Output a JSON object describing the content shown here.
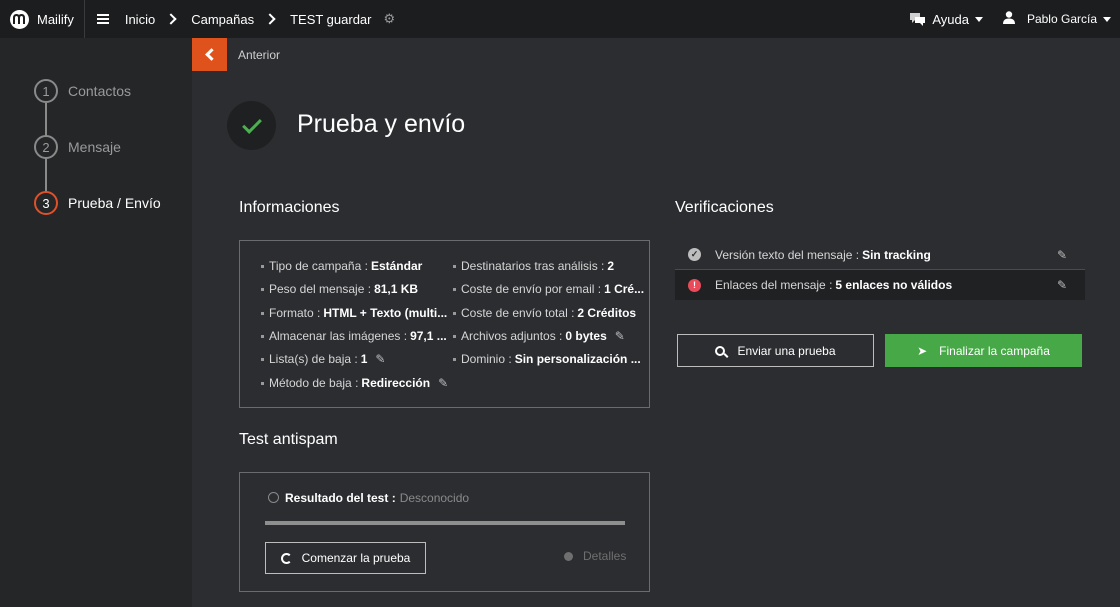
{
  "topbar": {
    "logo_text": "Mailify",
    "breadcrumbs": [
      "Inicio",
      "Campañas",
      "TEST guardar"
    ],
    "help_label": "Ayuda",
    "user_name": "Pablo García"
  },
  "sidebar": {
    "steps": [
      {
        "num": "1",
        "label": "Contactos"
      },
      {
        "num": "2",
        "label": "Mensaje"
      },
      {
        "num": "3",
        "label": "Prueba / Envío"
      }
    ]
  },
  "main": {
    "back_label": "Anterior",
    "page_title": "Prueba y envío",
    "info_title": "Informaciones",
    "info_left": [
      {
        "label": "Tipo de campaña :",
        "value": "Estándar"
      },
      {
        "label": "Peso del mensaje :",
        "value": "81,1 KB"
      },
      {
        "label": "Formato :",
        "value": "HTML + Texto (multi..."
      },
      {
        "label": "Almacenar las imágenes :",
        "value": "97,1 ..."
      },
      {
        "label": "Lista(s) de baja :",
        "value": "1"
      },
      {
        "label": "Método de baja :",
        "value": "Redirección"
      }
    ],
    "info_right": [
      {
        "label": "Destinatarios tras análisis :",
        "value": "2"
      },
      {
        "label": "Coste de envío por email :",
        "value": "1 Cré..."
      },
      {
        "label": "Coste de envío total :",
        "value": "2 Créditos"
      },
      {
        "label": "Archivos adjuntos :",
        "value": "0 bytes"
      },
      {
        "label": "Dominio :",
        "value": "Sin personalización ..."
      }
    ],
    "antispam_title": "Test antispam",
    "antispam": {
      "result_label": "Resultado del test :",
      "result_value": "Desconocido",
      "start_label": "Comenzar la prueba",
      "details_label": "Detalles",
      "progress": 0
    },
    "verif_title": "Verificaciones",
    "verifications": [
      {
        "label": "Versión texto del mensaje :",
        "value": "Sin tracking"
      },
      {
        "label": "Enlaces del mensaje :",
        "value": "5 enlaces no válidos"
      }
    ],
    "send_test_label": "Enviar una prueba",
    "finalize_label": "Finalizar la campaña"
  },
  "colors": {
    "accent": "#e0521c",
    "success": "#47a847",
    "error": "#e94b5a"
  }
}
